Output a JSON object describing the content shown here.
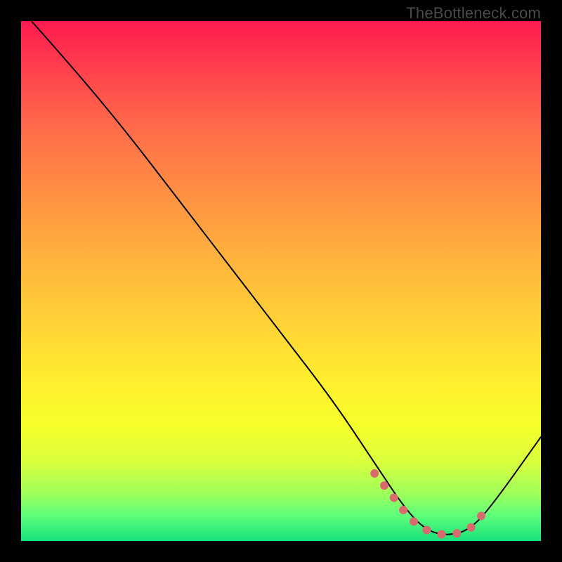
{
  "attribution": "TheBottleneck.com",
  "chart_data": {
    "type": "line",
    "title": "",
    "xlabel": "",
    "ylabel": "",
    "xlim": [
      0,
      100
    ],
    "ylim": [
      0,
      100
    ],
    "series": [
      {
        "name": "bottleneck-curve",
        "stroke": "#000000",
        "x": [
          2,
          10,
          20,
          30,
          40,
          50,
          60,
          68,
          74,
          78,
          82,
          86,
          90,
          100
        ],
        "y": [
          100,
          91,
          79,
          66,
          53,
          40,
          27,
          15,
          6,
          2,
          1,
          2,
          6,
          20
        ]
      },
      {
        "name": "optimal-band",
        "stroke": "#d96b6e",
        "x": [
          68,
          72,
          75,
          78,
          80,
          82,
          84,
          86,
          88,
          90
        ],
        "y": [
          13,
          8,
          4,
          2,
          1.5,
          1,
          1.5,
          2,
          4,
          7
        ]
      }
    ],
    "background_gradient": {
      "top": "#ff1a50",
      "bottom": "#18e27a"
    }
  }
}
